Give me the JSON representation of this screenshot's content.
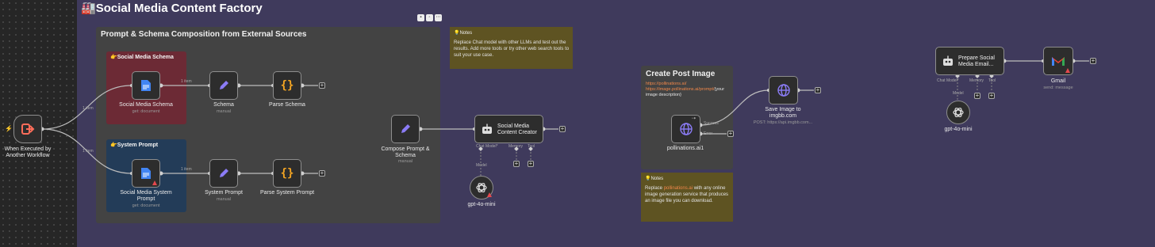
{
  "workflow": {
    "title": "Social Media Content Factory",
    "title_icon": "factory-emoji"
  },
  "groups": {
    "prompt_schema": {
      "title": "Prompt & Schema Composition from External Sources"
    },
    "social_schema": {
      "title": "Social Media Schema"
    },
    "system_prompt": {
      "title": "System Prompt"
    },
    "create_post_image": {
      "title": "Create Post Image",
      "link1": "https://pollinations.ai/",
      "link2": "https://image.pollinations.ai/prompt/",
      "link2_suffix": "{your image description}"
    }
  },
  "notes": {
    "note1": {
      "head": "💡Notes",
      "body": "Replace Chat model with other LLMs and test out the results. Add more tools or try other web search tools to suit your use case."
    },
    "note2": {
      "head": "💡Notes",
      "body_pre": "Replace ",
      "body_link": "pollinations.ai",
      "body_post": " with any online image generation service that produces an image file you can download."
    }
  },
  "nodes": {
    "trigger": {
      "label1": "When Executed by",
      "label2": "Another Workflow"
    },
    "sm_schema": {
      "label": "Social Media Schema",
      "sub": "get: document"
    },
    "schema": {
      "label": "Schema",
      "sub": "manual"
    },
    "parse_schema": {
      "label": "Parse Schema"
    },
    "sm_system_prompt": {
      "label1": "Social Media System",
      "label2": "Prompt",
      "sub": "get: document"
    },
    "system_prompt": {
      "label": "System Prompt",
      "sub": "manual"
    },
    "parse_system_prompt": {
      "label": "Parse System Prompt"
    },
    "compose": {
      "label1": "Compose Prompt &",
      "label2": "Schema",
      "sub": "manual"
    },
    "creator": {
      "label1": "Social Media",
      "label2": "Content Creator",
      "port_chat": "Chat Model*",
      "port_memory": "Memory",
      "port_tool": "Tool"
    },
    "gpt1": {
      "label": "gpt-4o-mini",
      "port": "Model"
    },
    "pollinations": {
      "label": "pollinations.ai1",
      "out_success": "Success",
      "out_error": "Error"
    },
    "save_image": {
      "label1": "Save Image to",
      "label2": "imgbb.com",
      "sub": "POST: https://api.imgbb.com..."
    },
    "prepare_email": {
      "label1": "Prepare Social",
      "label2": "Media Email...",
      "port_chat": "Chat Model*",
      "port_memory": "Memory",
      "port_tool": "Tool"
    },
    "gpt2": {
      "label": "gpt-4o-mini",
      "port": "Model"
    },
    "gmail": {
      "label": "Gmail",
      "sub": "send: message"
    }
  },
  "edges": {
    "e1": "1 item",
    "e2": "1 item",
    "e3": "1 item",
    "e4": "1 item"
  },
  "colors": {
    "canvas": "#3f3a5c",
    "group": "#434343",
    "schema_group": "#6c2a35",
    "prompt_group": "#233c58",
    "note": "#5e5322",
    "link": "#f0874a",
    "trigger": "#ff6d5a",
    "docs": "#4285f4",
    "edit": "#8b7cf6",
    "code": "#f5a623"
  }
}
